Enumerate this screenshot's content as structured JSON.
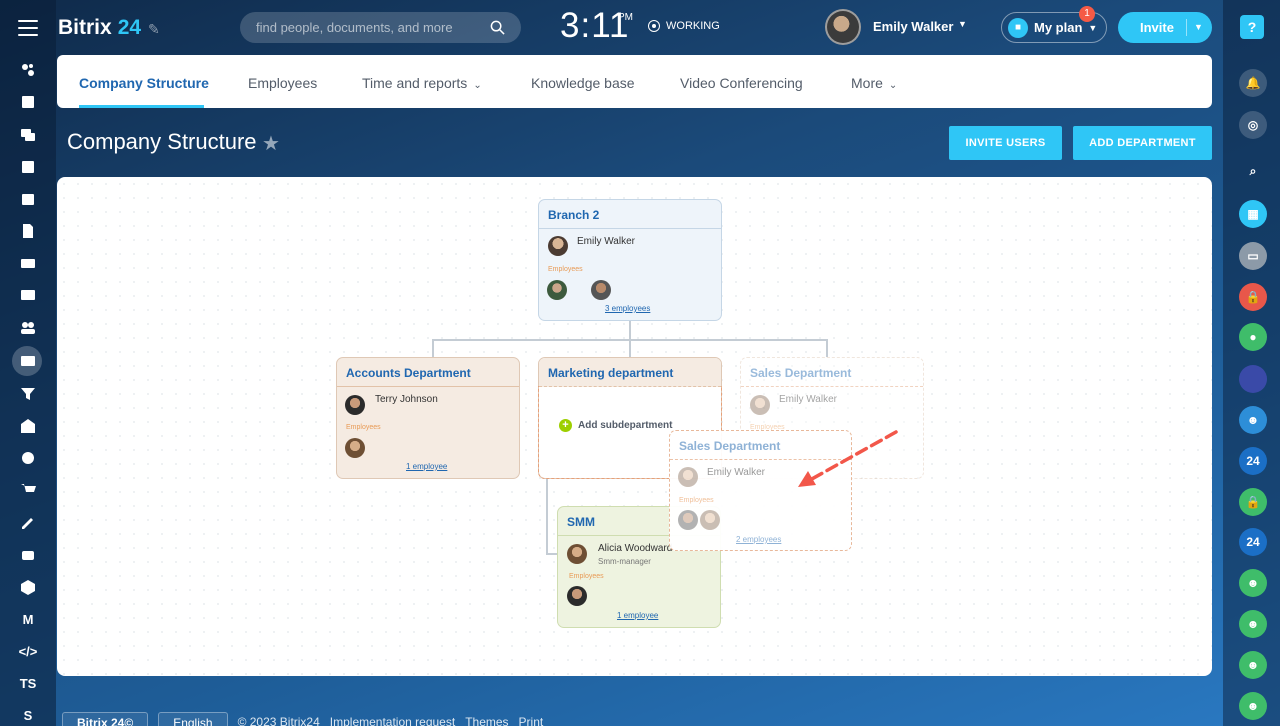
{
  "header": {
    "logo_text": "Bitrix",
    "logo_num": "24",
    "search_placeholder": "find people, documents, and more",
    "clock": "3:11",
    "ampm": "PM",
    "status": "WORKING",
    "user_name": "Emily Walker",
    "plan_label": "My plan",
    "plan_badge": "1",
    "invite_label": "Invite"
  },
  "left_sidebar": {
    "items": [
      "ts-label",
      "s-label"
    ],
    "ts": "TS",
    "s": "S"
  },
  "tabs": [
    {
      "label": "Company Structure",
      "active": true
    },
    {
      "label": "Employees"
    },
    {
      "label": "Time and reports"
    },
    {
      "label": "Knowledge base"
    },
    {
      "label": "Video Conferencing"
    },
    {
      "label": "More"
    }
  ],
  "page": {
    "title": "Company Structure",
    "invite_users": "INVITE USERS",
    "add_department": "ADD DEPARTMENT"
  },
  "structure": {
    "branch": {
      "name": "Branch 2",
      "head": "Emily Walker",
      "employees_label": "Employees",
      "count": "3 employees"
    },
    "accounts": {
      "name": "Accounts Department",
      "head": "Terry Johnson",
      "employees_label": "Employees",
      "count": "1 employee"
    },
    "marketing": {
      "name": "Marketing department",
      "add_sub": "Add subdepartment"
    },
    "sales_ghost": {
      "name": "Sales Department",
      "head": "Emily Walker",
      "employees_label": "Employees"
    },
    "sales_drag": {
      "name": "Sales Department",
      "head": "Emily Walker",
      "employees_label": "Employees",
      "count": "2 employees"
    },
    "smm": {
      "name": "SMM",
      "head": "Alicia Woodward",
      "role": "Smm-manager",
      "employees_label": "Employees",
      "count": "1 employee"
    }
  },
  "footer": {
    "logo": "Bitrix 24©",
    "language": "English",
    "copyright": "© 2023 Bitrix24",
    "implementation": "Implementation request",
    "themes": "Themes",
    "print": "Print"
  },
  "colors": {
    "accent": "#2fc6f6",
    "link": "#2067b0",
    "badge": "#f55a45",
    "arrow": "#f2574a"
  }
}
